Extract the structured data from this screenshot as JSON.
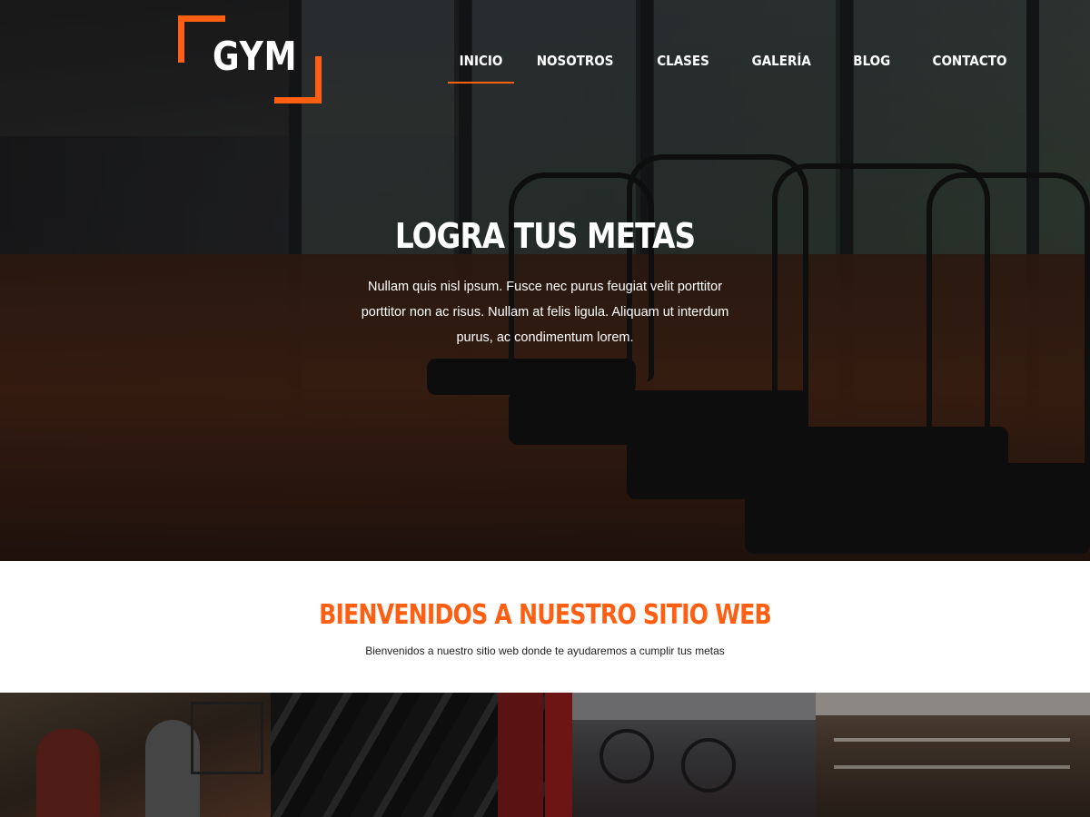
{
  "logo": {
    "text": "GYM"
  },
  "nav": {
    "items": [
      {
        "label": "INICIO",
        "active": true
      },
      {
        "label": "NOSOTROS",
        "active": false
      },
      {
        "label": "CLASES",
        "active": false
      },
      {
        "label": "GALERÍA",
        "active": false
      },
      {
        "label": "BLOG",
        "active": false
      },
      {
        "label": "CONTACTO",
        "active": false
      }
    ]
  },
  "hero": {
    "title": "LOGRA TUS METAS",
    "text": "Nullam quis nisl ipsum. Fusce nec purus feugiat velit porttitor porttitor non ac risus. Nullam at felis ligula. Aliquam ut interdum purus, ac condimentum lorem."
  },
  "welcome": {
    "title": "BIENVENIDOS A NUESTRO SITIO WEB",
    "text": "Bienvenidos a nuestro sitio web donde te ayudaremos a cumplir tus metas"
  },
  "colors": {
    "accent": "#ff5f12",
    "hero_overlay": "#000000",
    "text_light": "#ffffff",
    "text_dark": "#222222"
  },
  "gallery": {
    "items": [
      {
        "icon": "class-photo"
      },
      {
        "icon": "dumbbells-photo"
      },
      {
        "icon": "spin-bikes-photo"
      },
      {
        "icon": "gym-floor-photo"
      }
    ]
  }
}
